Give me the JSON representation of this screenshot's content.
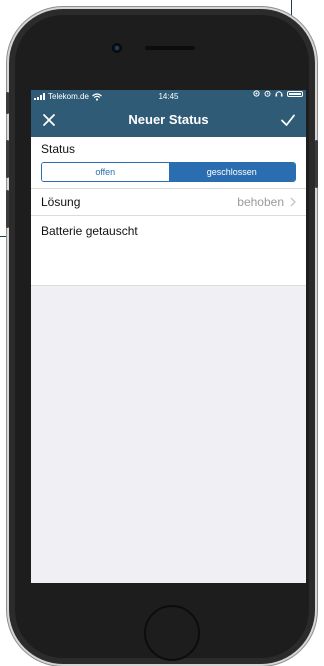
{
  "statusbar": {
    "carrier": "Telekom.de",
    "time": "14:45"
  },
  "navbar": {
    "title": "Neuer Status",
    "close_icon": "close-icon",
    "confirm_icon": "checkmark-icon"
  },
  "status": {
    "label": "Status",
    "options": [
      "offen",
      "geschlossen"
    ],
    "selected": "geschlossen"
  },
  "solution": {
    "label": "Lösung",
    "value": "behoben"
  },
  "note": {
    "text": "Batterie getauscht"
  },
  "colors": {
    "header": "#2f5b77",
    "accent": "#2a6db0",
    "background": "#efeff4"
  }
}
